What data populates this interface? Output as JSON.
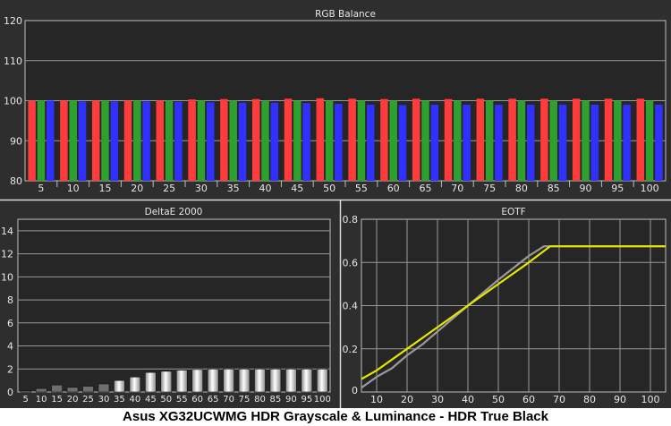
{
  "caption": "Asus XG32UCWMG HDR Grayscale & Luminance - HDR True Black",
  "colors": {
    "red": "#ff3b3b",
    "green": "#2ea02e",
    "blue": "#3030ff",
    "panel": "#262626",
    "frame": "#2e2e2e"
  },
  "chart_data": [
    {
      "type": "bar",
      "title": "RGB Balance",
      "categories": [
        "5",
        "10",
        "15",
        "20",
        "25",
        "30",
        "35",
        "40",
        "45",
        "50",
        "55",
        "60",
        "65",
        "70",
        "75",
        "80",
        "85",
        "90",
        "95",
        "100"
      ],
      "ylim": [
        80,
        120
      ],
      "yticks": [
        "80",
        "90",
        "100",
        "110",
        "120"
      ],
      "grid": true,
      "series": [
        {
          "color": "#ff3b3b",
          "values": [
            100,
            100,
            100,
            100,
            100,
            100.3,
            100.4,
            100.4,
            100.5,
            100.6,
            100.5,
            100.4,
            100.5,
            100.4,
            100.5,
            100.5,
            100.5,
            100.5,
            100.5,
            100.5
          ]
        },
        {
          "color": "#2ea02e",
          "values": [
            100,
            100,
            100,
            100,
            100,
            100,
            100,
            100,
            100,
            100,
            100,
            100,
            100,
            100,
            100,
            100,
            100,
            100,
            100,
            100
          ]
        },
        {
          "color": "#3030ff",
          "values": [
            100,
            99.8,
            99.8,
            99.8,
            99.7,
            99.6,
            99.5,
            99.5,
            99.4,
            99.2,
            99,
            98.9,
            99,
            99,
            99,
            99,
            99,
            99,
            99,
            99
          ]
        }
      ]
    },
    {
      "type": "bar",
      "title": "DeltaE 2000",
      "categories": [
        "5",
        "10",
        "15",
        "20",
        "25",
        "30",
        "35",
        "40",
        "45",
        "50",
        "55",
        "60",
        "65",
        "70",
        "75",
        "80",
        "85",
        "90",
        "95",
        "100"
      ],
      "ylim": [
        0,
        15
      ],
      "yticks": [
        "0",
        "2",
        "4",
        "6",
        "8",
        "10",
        "12",
        "14"
      ],
      "grid": true,
      "values": [
        0.1,
        0.3,
        0.6,
        0.4,
        0.5,
        0.7,
        1.0,
        1.3,
        1.7,
        1.8,
        1.9,
        1.95,
        2,
        2,
        2,
        2,
        2,
        2,
        2,
        2
      ]
    },
    {
      "type": "line",
      "title": "EOTF",
      "xlim": [
        5,
        105
      ],
      "ylim": [
        0,
        0.8
      ],
      "xticks": [
        "10",
        "20",
        "30",
        "40",
        "50",
        "60",
        "70",
        "80",
        "90",
        "100"
      ],
      "yticks": [
        "0",
        "0.2",
        "0.4",
        "0.6",
        "0.8"
      ],
      "grid": true,
      "series": [
        {
          "color": "#e6e600",
          "x": [
            5,
            10,
            20,
            30,
            40,
            50,
            60,
            67,
            70,
            80,
            90,
            100,
            105
          ],
          "y": [
            0.06,
            0.1,
            0.2,
            0.3,
            0.4,
            0.5,
            0.6,
            0.675,
            0.675,
            0.675,
            0.675,
            0.675,
            0.675
          ]
        },
        {
          "color": "#9a9a9a",
          "x": [
            5,
            10,
            15,
            20,
            25,
            30,
            40,
            50,
            60,
            65,
            70,
            80,
            90,
            100,
            105
          ],
          "y": [
            0.02,
            0.07,
            0.11,
            0.17,
            0.22,
            0.28,
            0.4,
            0.52,
            0.63,
            0.675,
            0.675,
            0.675,
            0.675,
            0.675,
            0.675
          ]
        }
      ]
    }
  ]
}
